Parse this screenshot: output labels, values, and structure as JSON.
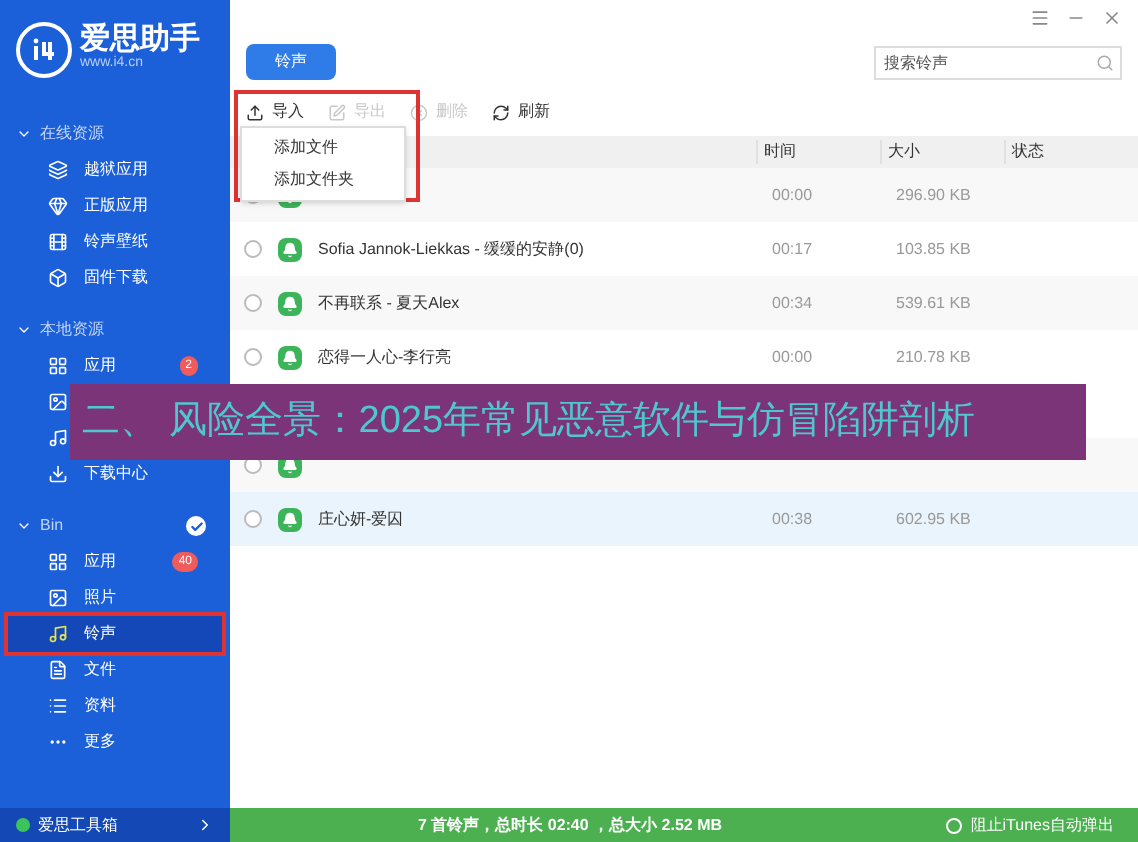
{
  "app": {
    "name": "爱思助手",
    "url": "www.i4.cn"
  },
  "sidebar": {
    "sections": [
      {
        "title": "在线资源",
        "badge_check": false,
        "items": [
          {
            "label": "越狱应用",
            "selected": false
          },
          {
            "label": "正版应用",
            "selected": false
          },
          {
            "label": "铃声壁纸",
            "selected": false
          },
          {
            "label": "固件下载",
            "selected": false
          }
        ]
      },
      {
        "title": "本地资源",
        "badge_check": false,
        "items": [
          {
            "label": "应用",
            "badge": "2",
            "selected": false
          },
          {
            "selected": false
          },
          {
            "selected": false
          },
          {
            "label": "下载中心",
            "selected": false
          }
        ]
      },
      {
        "title": "Bin",
        "badge_check": true,
        "items": [
          {
            "label": "应用",
            "badge": "40",
            "selected": false
          },
          {
            "label": "照片",
            "selected": false
          },
          {
            "label": "铃声",
            "selected": true
          },
          {
            "label": "文件",
            "selected": false
          },
          {
            "label": "资料",
            "selected": false
          },
          {
            "label": "更多",
            "selected": false
          }
        ]
      }
    ],
    "footer": "爱思工具箱"
  },
  "tab_button": "铃声",
  "search": {
    "placeholder": "搜索铃声"
  },
  "toolbar": [
    {
      "label": "导入",
      "disabled": false
    },
    {
      "label": "导出",
      "disabled": true
    },
    {
      "label": "删除",
      "disabled": true
    },
    {
      "label": "刷新",
      "disabled": false
    }
  ],
  "dropdown": [
    "添加文件",
    "添加文件夹"
  ],
  "table": {
    "columns": [
      "时间",
      "大小",
      "状态"
    ],
    "rows": [
      {
        "time": "00:00",
        "size": "296.90 KB",
        "selected": false
      },
      {
        "name": "Sofia Jannok-Liekkas - 缓缓的安静(0)",
        "time": "00:17",
        "size": "103.85 KB",
        "selected": false
      },
      {
        "name": "不再联系 - 夏天Alex",
        "time": "00:34",
        "size": "539.61 KB",
        "selected": false
      },
      {
        "name": "恋得一人心-李行亮",
        "time": "00:00",
        "size": "210.78 KB",
        "selected": false
      },
      {
        "selected": false
      },
      {
        "name": "庄心妍-爱囚",
        "time": "00:38",
        "size": "602.95 KB",
        "selected": true
      }
    ]
  },
  "status_bar": {
    "summary": "7 首铃声，总时长 02:40 ，总大小 2.52 MB",
    "option": {
      "label": "阻止iTunes自动弹出",
      "checked": false
    }
  },
  "banner": "二、 风险全景：2025年常见恶意软件与仿冒陷阱剖析"
}
